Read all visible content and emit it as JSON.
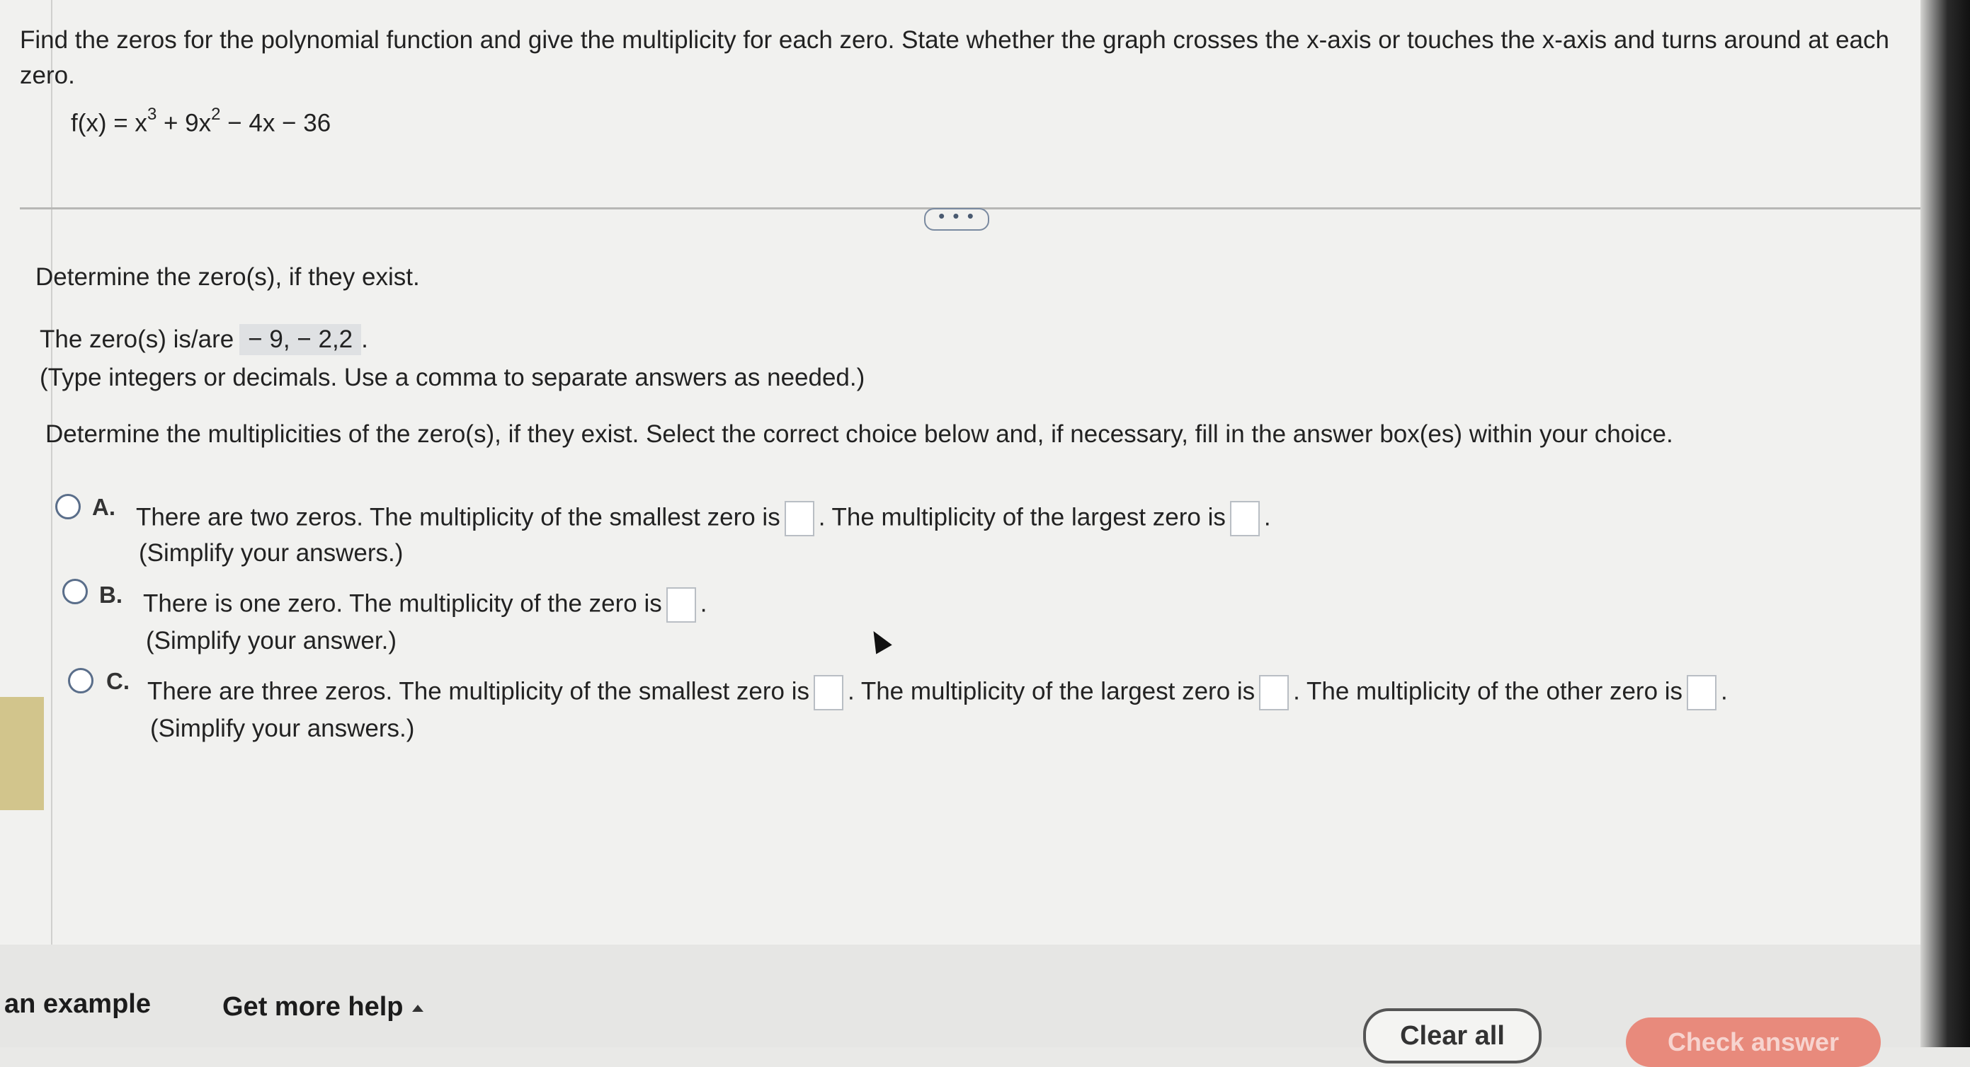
{
  "question": {
    "prompt": "Find the zeros for the polynomial function and give the multiplicity for each zero.  State whether the graph crosses the x-axis or touches the x-axis and turns around at each zero.",
    "formula_lhs": "f(x) = x",
    "exp1": "3",
    "formula_mid": " + 9x",
    "exp2": "2",
    "formula_rhs": " − 4x − 36"
  },
  "more_button": "• • •",
  "part1": {
    "heading": "Determine the zero(s), if they exist.",
    "answer_prefix": "The zero(s) is/are",
    "answer_value": "− 9, − 2,2",
    "answer_suffix": ".",
    "hint": "(Type integers or decimals. Use a comma to separate answers as needed.)"
  },
  "part2": {
    "heading": "Determine the multiplicities of the zero(s), if they exist. Select the correct choice below and, if necessary, fill in the answer box(es) within your choice.",
    "choices": [
      {
        "letter": "A.",
        "text1": "There are two zeros. The multiplicity of the smallest zero is",
        "text2": ". The multiplicity of the largest zero is",
        "end": ".",
        "hint": "(Simplify your answers.)"
      },
      {
        "letter": "B.",
        "text1": "There is one zero. The multiplicity of the zero is",
        "end": ".",
        "hint": "(Simplify your answer.)"
      },
      {
        "letter": "C.",
        "text1": "There are three zeros. The multiplicity of the smallest zero is",
        "text2": ". The multiplicity of the largest zero is",
        "text3": ". The multiplicity of the other zero is",
        "end": ".",
        "hint": "(Simplify your answers.)"
      }
    ]
  },
  "footer": {
    "example_link": "an example",
    "help_link": "Get more help",
    "clear_button": "Clear all",
    "check_button": "Check answer"
  }
}
